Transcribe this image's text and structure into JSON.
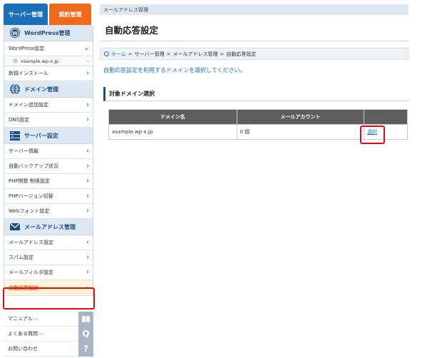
{
  "top_tabs": {
    "server": "サーバー管理",
    "contract": "契約管理"
  },
  "sidebar": {
    "wordpress": {
      "title": "WordPress管理",
      "items": [
        {
          "label": "WordPress設定"
        }
      ],
      "subitem": "xsample.wp-x.jp"
    },
    "domain": {
      "title": "ドメイン管理",
      "items": [
        {
          "label": "新規インストール"
        },
        {
          "label": "ドメイン追加設定"
        },
        {
          "label": "DNS設定"
        }
      ]
    },
    "server": {
      "title": "サーバー設定",
      "items": [
        {
          "label": "サーバー情報"
        },
        {
          "label": "自動バックアップ状況"
        },
        {
          "label": "PHP関数 制限設定"
        },
        {
          "label": "PHPバージョン切替"
        },
        {
          "label": "Webフォント設定"
        }
      ]
    },
    "mail": {
      "title": "メールアドレス管理",
      "items": [
        {
          "label": "メールアドレス設定"
        },
        {
          "label": "スパム設定"
        },
        {
          "label": "メールフィルタ設定"
        },
        {
          "label": "自動応答設定"
        }
      ]
    },
    "help": [
      {
        "label": "マニュアル",
        "icon": "book-icon"
      },
      {
        "label": "よくある質問",
        "icon": "q-icon"
      },
      {
        "label": "お問い合わせ",
        "icon": "question-icon"
      }
    ]
  },
  "main": {
    "top_crumb": "メールアドレス管理",
    "title": "自動応答設定",
    "breadcrumb": [
      "ホーム",
      "サーバー管理",
      "メールアドレス管理",
      "自動応答設定"
    ],
    "instruction": "自動応答設定を利用するドメインを選択してください。",
    "section_title": "対象ドメイン選択",
    "table": {
      "headers": [
        "ドメイン名",
        "メールアカウント",
        ""
      ],
      "rows": [
        {
          "domain": "xsample.wp-x.jp",
          "accounts": "0 個",
          "action": "選択"
        }
      ]
    }
  },
  "colors": {
    "brand_blue": "#1a6fb9",
    "orange": "#ee6a1a",
    "highlight_red": "#e00914"
  }
}
